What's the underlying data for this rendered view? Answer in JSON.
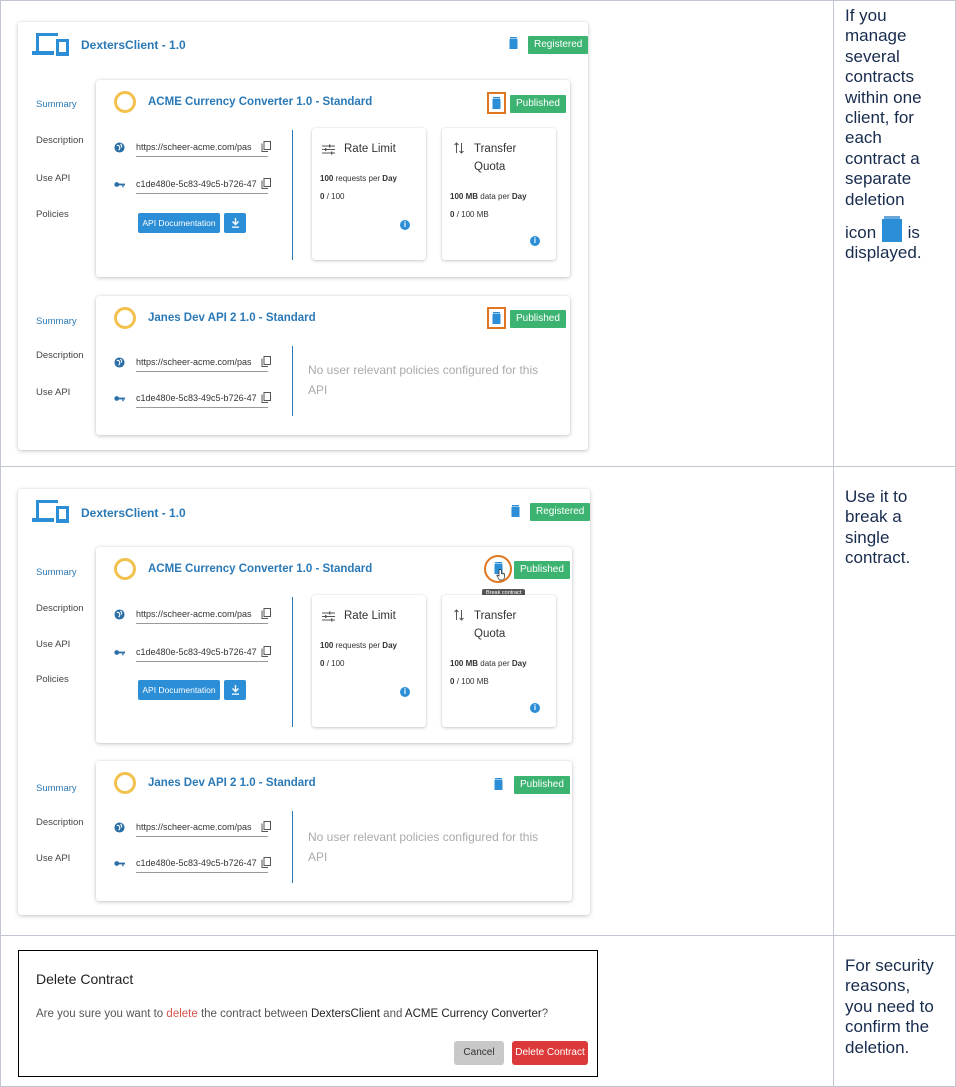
{
  "rows": [
    {
      "description": [
        "If you",
        "manage",
        "several",
        "contracts",
        "within one",
        "client, for",
        "each",
        "contract a",
        "separate",
        "deletion",
        "icon",
        "is",
        "displayed."
      ]
    },
    {
      "description": [
        "Use it to",
        "break a",
        "single",
        "contract."
      ]
    },
    {
      "description": [
        "For security",
        "reasons,",
        "you need to",
        "confirm the",
        "deletion."
      ]
    }
  ],
  "client": {
    "name": "DextersClient - 1.0",
    "status": "Registered"
  },
  "contracts": [
    {
      "api_name": "ACME Currency Converter 1.0 - Standard",
      "status": "Published",
      "nav": [
        "Summary",
        "Description",
        "Use API",
        "Policies"
      ],
      "endpoint": "https://scheer-acme.com/pas",
      "api_key": "c1de480e-5c83-49c5-b726-47",
      "doc_button": "API Documentation",
      "rate_limit": {
        "title": "Rate Limit",
        "limit_value": "100",
        "limit_text": "requests per",
        "period": "Day",
        "used": "0",
        "max": "/ 100"
      },
      "transfer": {
        "title_1": "Transfer",
        "title_2": "Quota",
        "limit_value": "100 MB",
        "limit_text": "data per",
        "period": "Day",
        "used": "0",
        "max": "/ 100 MB"
      }
    },
    {
      "api_name": "Janes Dev API 2 1.0 - Standard",
      "status": "Published",
      "nav": [
        "Summary",
        "Description",
        "Use API"
      ],
      "endpoint": "https://scheer-acme.com/pas",
      "api_key": "c1de480e-5c83-49c5-b726-47",
      "no_policies_1": "No user relevant policies configured for this",
      "no_policies_2": "API"
    }
  ],
  "tooltip": "Break contract",
  "dialog": {
    "title": "Delete Contract",
    "text_1": "Are you sure you want to",
    "text_delete": "delete",
    "text_2": "the contract between",
    "client": "DextersClient",
    "text_and": "and",
    "api": "ACME Currency Converter",
    "text_end": "?",
    "cancel": "Cancel",
    "confirm": "Delete Contract"
  },
  "colors": {
    "accent": "#2a79b7",
    "success": "#3cb371",
    "highlight": "#e0761f",
    "danger": "#dc3a3a"
  }
}
